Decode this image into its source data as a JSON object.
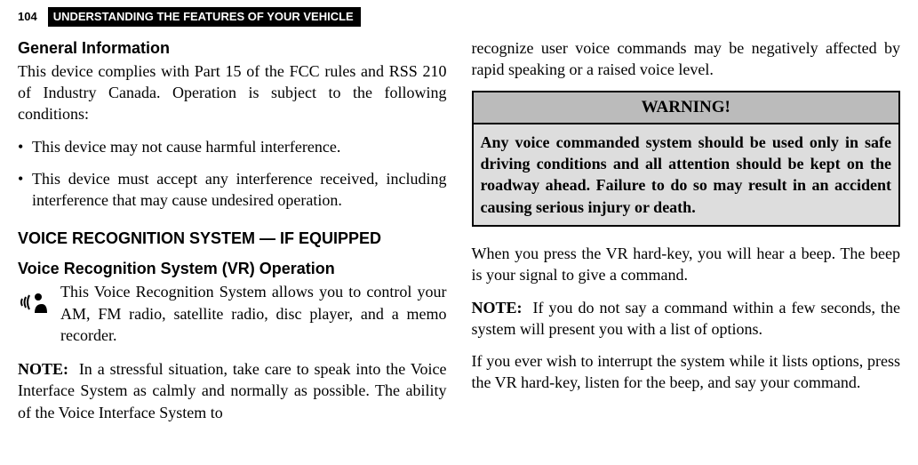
{
  "header": {
    "page_num": "104",
    "title": "UNDERSTANDING THE FEATURES OF YOUR VEHICLE"
  },
  "left": {
    "h_general": "General Information",
    "p_general": "This device complies with Part 15 of the FCC rules and RSS 210 of Industry Canada. Operation is subject to the following conditions:",
    "bullets": [
      "This device may not cause harmful interference.",
      "This device must accept any interference received, including interference that may cause undesired operation."
    ],
    "h_voice_section": "VOICE RECOGNITION SYSTEM — IF EQUIPPED",
    "h_voice_op": "Voice Recognition System (VR) Operation",
    "p_voice_op": "This Voice Recognition System allows you to control your AM, FM radio, satellite radio, disc player, and a memo recorder.",
    "note_label": "NOTE:",
    "note_text": "In a stressful situation, take care to speak into the Voice Interface System as calmly and normally as possible. The ability of the Voice Interface System to"
  },
  "right": {
    "p_cont": "recognize user voice commands may be negatively affected by rapid speaking or a raised voice level.",
    "warning_title": "WARNING!",
    "warning_body": "Any voice commanded system should be used only in safe driving conditions and all attention should be kept on the roadway ahead. Failure to do so may result in an accident causing serious injury or death.",
    "p_beep": "When you press the VR hard-key, you will hear a beep. The beep is your signal to give a command.",
    "note_label": "NOTE:",
    "note_text": "If you do not say a command within a few seconds, the system will present you with a list of options.",
    "p_interrupt": "If you ever wish to interrupt the system while it lists options, press the VR hard-key, listen for the beep, and say your command."
  }
}
